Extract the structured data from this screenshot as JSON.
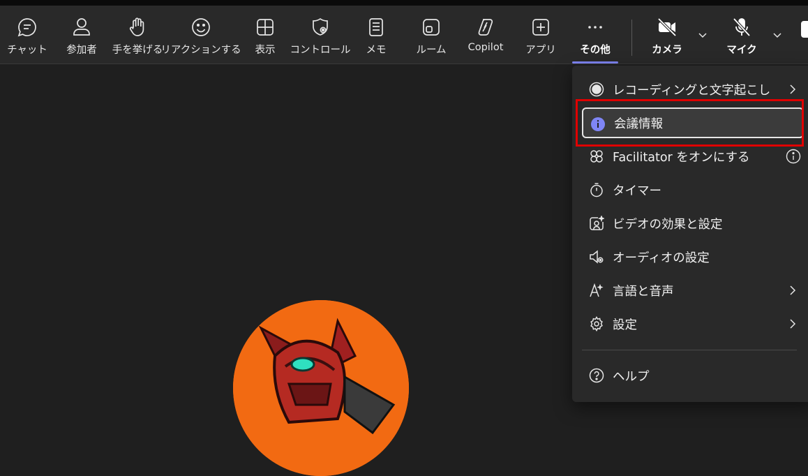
{
  "toolbar": {
    "items": [
      {
        "label": "チャット",
        "icon": "chat-icon"
      },
      {
        "label": "参加者",
        "icon": "people-icon"
      },
      {
        "label": "手を挙げる",
        "icon": "raise-hand-icon"
      },
      {
        "label": "リアクションする",
        "icon": "emoji-icon"
      },
      {
        "label": "表示",
        "icon": "view-grid-icon"
      },
      {
        "label": "コントロール",
        "icon": "shield-gear-icon"
      },
      {
        "label": "メモ",
        "icon": "notes-icon"
      },
      {
        "label": "ルーム",
        "icon": "rooms-icon"
      },
      {
        "label": "Copilot",
        "icon": "copilot-icon"
      },
      {
        "label": "アプリ",
        "icon": "add-apps-icon"
      },
      {
        "label": "その他",
        "icon": "more-icon"
      },
      {
        "label": "カメラ",
        "icon": "camera-off-icon"
      },
      {
        "label": "マイク",
        "icon": "mic-off-icon"
      }
    ]
  },
  "menu": {
    "items": [
      {
        "label": "レコーディングと文字起こし",
        "icon": "record-icon",
        "submenu": true
      },
      {
        "label": "会議情報",
        "icon": "info-icon",
        "selected": true
      },
      {
        "label": "Facilitator をオンにする",
        "icon": "facilitator-icon",
        "info": true
      },
      {
        "label": "タイマー",
        "icon": "timer-icon"
      },
      {
        "label": "ビデオの効果と設定",
        "icon": "video-effects-icon"
      },
      {
        "label": "オーディオの設定",
        "icon": "audio-settings-icon"
      },
      {
        "label": "言語と音声",
        "icon": "language-icon",
        "submenu": true
      },
      {
        "label": "設定",
        "icon": "gear-icon",
        "submenu": true
      },
      {
        "label": "ヘルプ",
        "icon": "help-icon"
      }
    ]
  },
  "colors": {
    "accent": "#7f85f5",
    "highlight": "#e00000",
    "background": "#1f1f1f",
    "toolbar": "#292929"
  }
}
